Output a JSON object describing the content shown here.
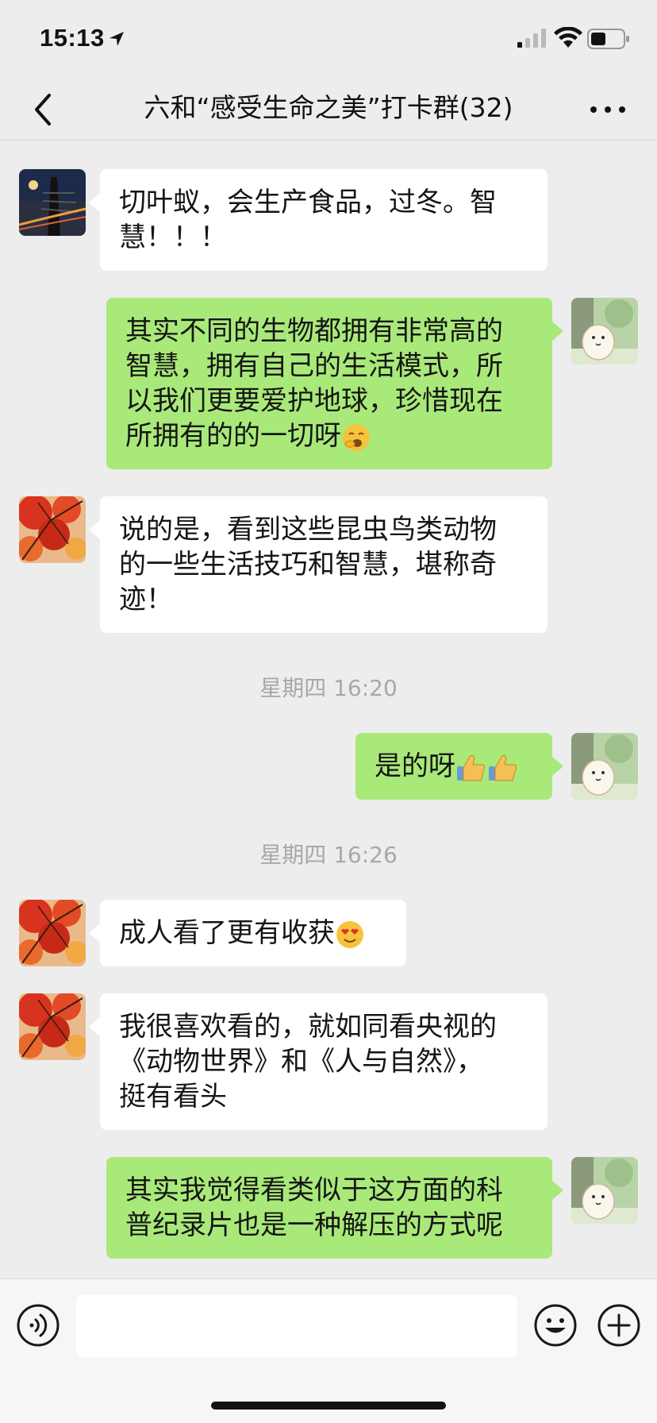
{
  "status_bar": {
    "time": "15:13",
    "icons": [
      "location-arrow-icon",
      "cellular-signal-icon",
      "wifi-icon",
      "battery-icon"
    ]
  },
  "header": {
    "title": "六和“感受生命之美”打卡群(32)",
    "back_icon": "chevron-left-icon",
    "more_icon": "ellipsis-icon"
  },
  "messages": [
    {
      "side": "left",
      "avatar": "night-bridge-avatar",
      "text": "切叶蚁，会生产食品，过冬。智\n慧！！！"
    },
    {
      "side": "right",
      "avatar": "cartoon-alpaca-avatar",
      "text": "其实不同的生物都拥有非常高的\n智慧，拥有自己的生活模式，所\n以我们更要爱护地球，珍惜现在\n所拥有的的一切呀",
      "emoji": "yawning-face-emoji"
    },
    {
      "side": "left",
      "avatar": "maple-leaves-avatar",
      "text": "说的是，看到这些昆虫鸟类动物\n的一些生活技巧和智慧，堪称奇\n迹！"
    },
    {
      "type": "time",
      "text": "星期四 16:20"
    },
    {
      "side": "right",
      "avatar": "cartoon-alpaca-avatar",
      "text": "是的呀",
      "emoji": "thumbs-up-emoji"
    },
    {
      "type": "time",
      "text": "星期四 16:26"
    },
    {
      "side": "left",
      "avatar": "maple-leaves-avatar",
      "text": "成人看了更有收获",
      "emoji": "heart-eyes-emoji"
    },
    {
      "side": "left",
      "avatar": "maple-leaves-avatar",
      "text": "我很喜欢看的，就如同看央视的\n《动物世界》和《人与自然》，\n挺有看头"
    },
    {
      "side": "right",
      "avatar": "cartoon-alpaca-avatar",
      "text": "其实我觉得看类似于这方面的科\n普纪录片也是一种解压的方式呢"
    }
  ],
  "input_bar": {
    "voice_icon": "voice-icon",
    "input_value": "",
    "emoji_icon": "smiley-icon",
    "plus_icon": "plus-circle-icon"
  },
  "colors": {
    "background": "#ededed",
    "bubble_left": "#ffffff",
    "bubble_right": "#a9e97a",
    "timestamp": "#a8a8a8"
  }
}
